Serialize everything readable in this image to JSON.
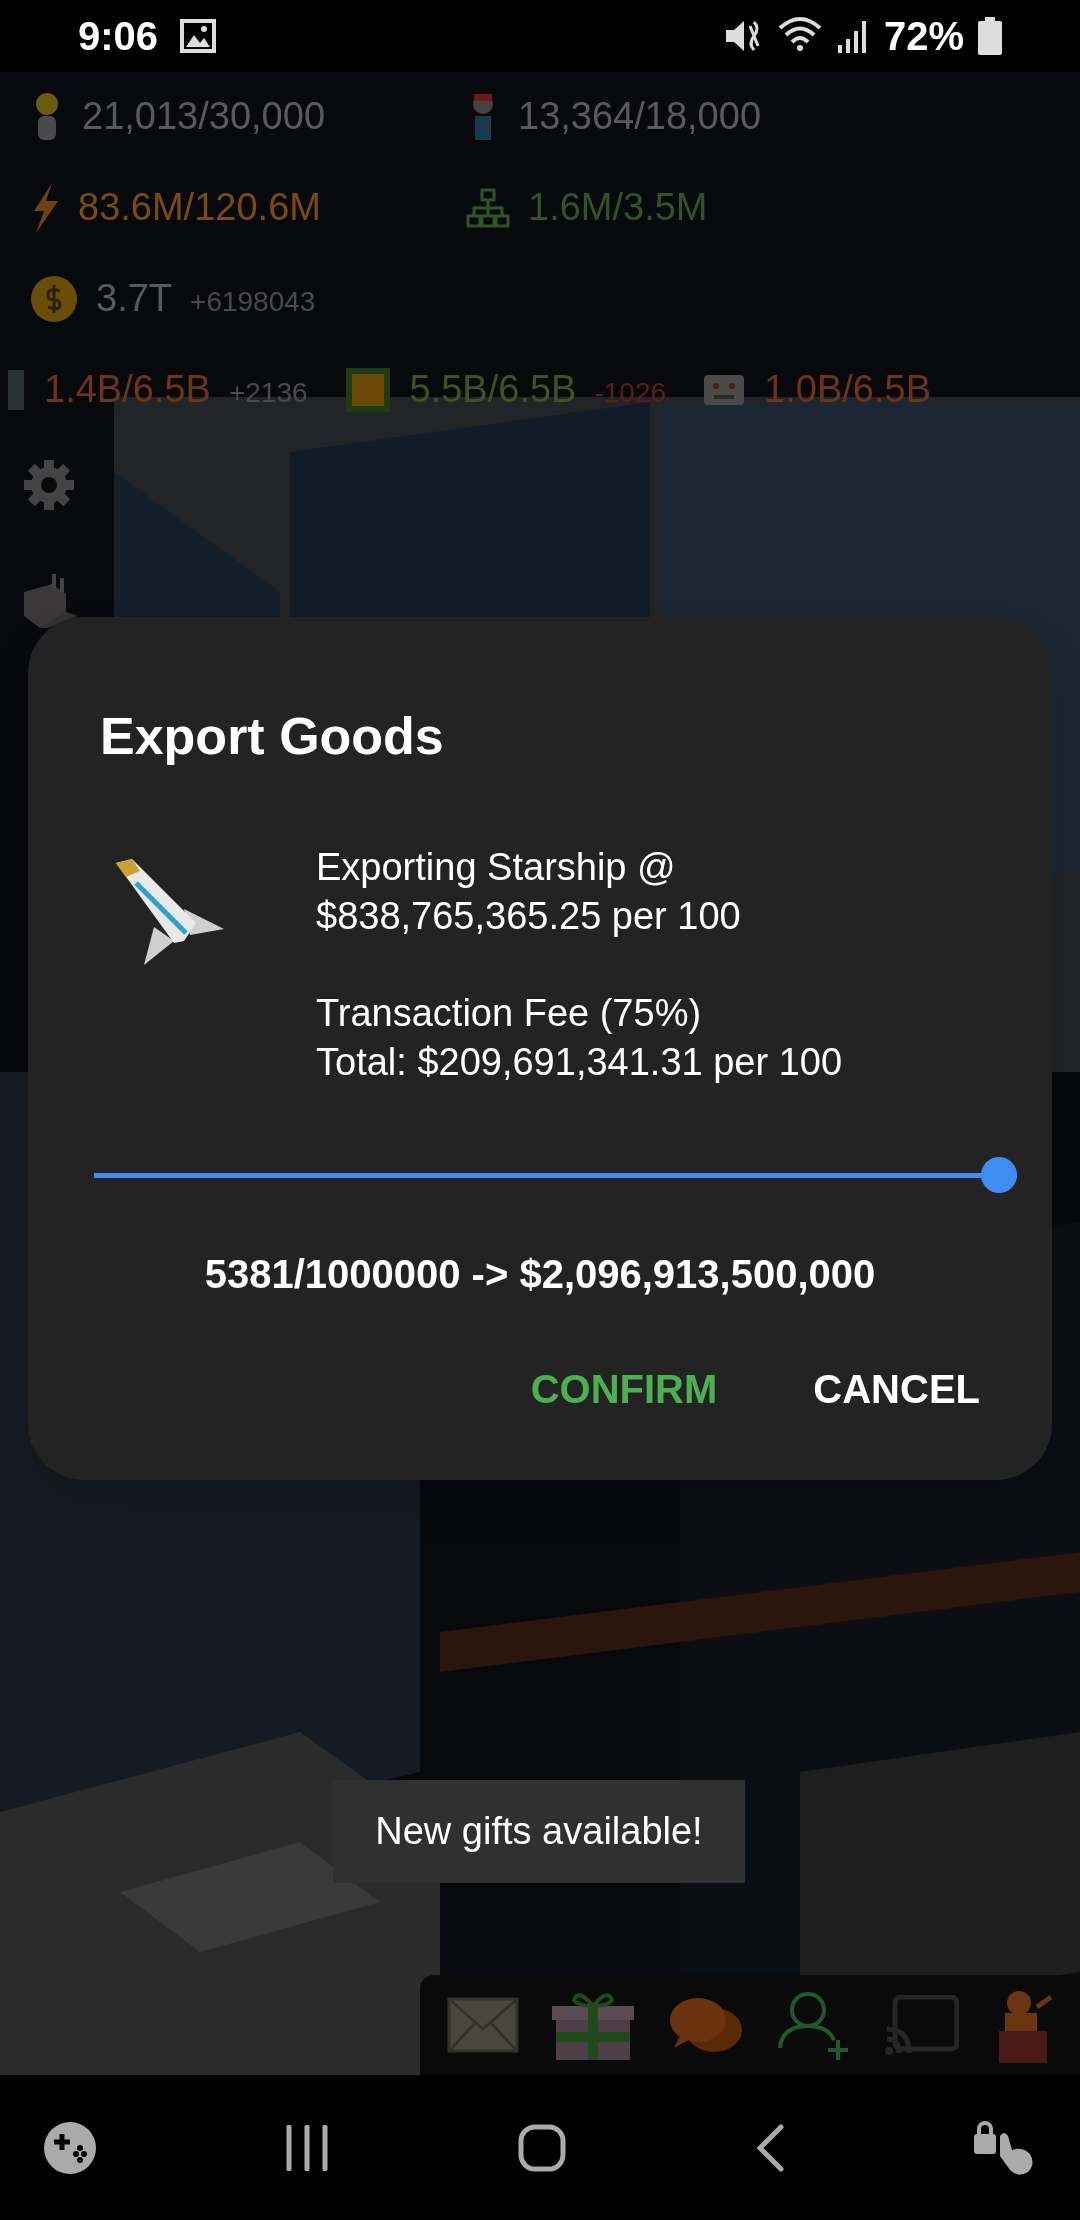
{
  "status_bar": {
    "time": "9:06",
    "battery": "72%"
  },
  "hud": {
    "rows": [
      [
        {
          "kind": "worker",
          "value": "21,013/30,000",
          "color": "#5a5a5a"
        },
        {
          "kind": "engineer",
          "value": "13,364/18,000",
          "color": "#5a5a5a"
        }
      ],
      [
        {
          "kind": "power",
          "value": "83.6M/120.6M",
          "color": "#7a4a12"
        },
        {
          "kind": "network",
          "value": "1.6M/3.5M",
          "color": "#2e5528"
        }
      ],
      [
        {
          "kind": "money",
          "value": "3.7T",
          "delta": {
            "text": "+6198043",
            "color": "#4a4a4a"
          },
          "color": "#5a5a5a"
        }
      ],
      [
        {
          "kind": "storage",
          "value": "1.4B/6.5B",
          "delta": {
            "text": "+2136",
            "color": "#4a4a4a"
          },
          "color": "#6e3418"
        },
        {
          "kind": "chip",
          "value": "5.5B/6.5B",
          "delta": {
            "text": "-1026",
            "color": "#5e1d16"
          },
          "color": "#3f5220"
        },
        {
          "kind": "robot",
          "value": "1.0B/6.5B",
          "color": "#6e3418"
        }
      ]
    ]
  },
  "dialog": {
    "title": "Export Goods",
    "lines": [
      [
        "Exporting Starship @",
        "$838,765,365.25 per 100"
      ],
      [
        "Transaction Fee (75%)",
        "Total: $209,691,341.31 per 100"
      ]
    ],
    "slider": {
      "level": 1.0
    },
    "summary": "5381/1000000 -> $2,096,913,500,000",
    "buttons": [
      {
        "label": "CONFIRM",
        "kind": "primary"
      },
      {
        "label": "CANCEL",
        "kind": "secondary"
      }
    ]
  },
  "toast": {
    "text": "New gifts available!"
  }
}
